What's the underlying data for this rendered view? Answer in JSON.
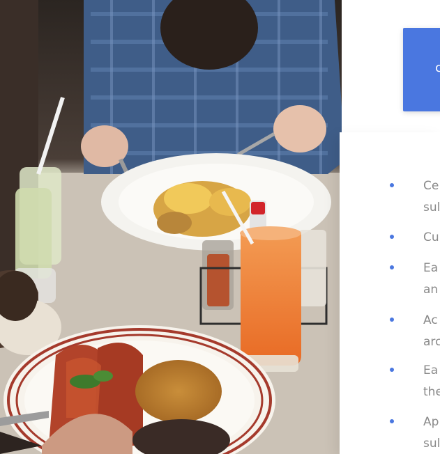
{
  "hero": {
    "image_alt": "Restaurant table with plates of food and a glass of juice"
  },
  "card": {
    "visible_char": "c",
    "accent_color": "#4a77e0"
  },
  "list": {
    "items": [
      {
        "line1": "Ce",
        "line2": "sul"
      },
      {
        "line1": "Cu",
        "line2": ""
      },
      {
        "line1": "Ea",
        "line2": "an"
      },
      {
        "line1": "Ac",
        "line2": "arc"
      },
      {
        "line1": "Ea",
        "line2": "the"
      },
      {
        "line1": "Ap",
        "line2": "sul"
      }
    ],
    "bullet_color": "#4a77e0"
  }
}
